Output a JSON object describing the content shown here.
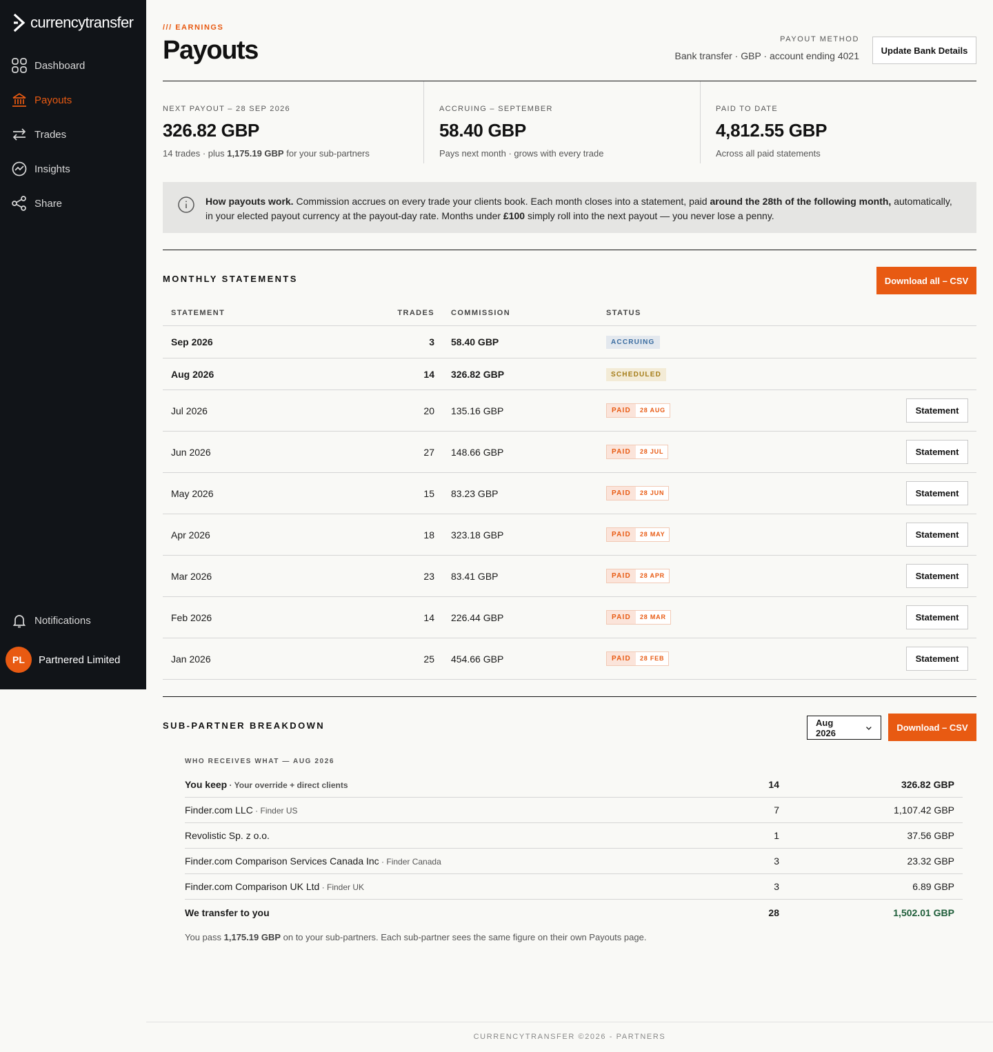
{
  "brand": {
    "name": "currencytransfer",
    "accent": "#e85a12"
  },
  "sidebar": {
    "items": [
      {
        "label": "Dashboard",
        "icon": "grid-icon"
      },
      {
        "label": "Payouts",
        "icon": "bank-icon",
        "active": true
      },
      {
        "label": "Trades",
        "icon": "arrows-exchange-icon"
      },
      {
        "label": "Insights",
        "icon": "chart-circle-icon"
      },
      {
        "label": "Share",
        "icon": "share-icon"
      }
    ],
    "notifications": "Notifications",
    "user": {
      "initials": "PL",
      "name": "Partnered Limited"
    }
  },
  "header": {
    "eyebrow": "/// EARNINGS",
    "title": "Payouts",
    "payout_method_label": "PAYOUT METHOD",
    "payout_method_value": "Bank transfer · GBP · account ending 4021",
    "update_bank_label": "Update Bank Details"
  },
  "summary": [
    {
      "label": "NEXT PAYOUT – 28 SEP 2026",
      "value": "326.82 GBP",
      "sub_pre": "14 trades · plus ",
      "sub_bold": "1,175.19 GBP",
      "sub_post": " for your sub-partners"
    },
    {
      "label": "ACCRUING – SEPTEMBER",
      "value": "58.40 GBP",
      "sub_pre": "Pays next month · grows with every trade",
      "sub_bold": "",
      "sub_post": ""
    },
    {
      "label": "PAID TO DATE",
      "value": "4,812.55 GBP",
      "sub_pre": "Across all paid statements",
      "sub_bold": "",
      "sub_post": ""
    }
  ],
  "info": {
    "bold1": "How payouts work.",
    "t1": " Commission accrues on every trade your clients book. Each month closes into a statement, paid ",
    "bold2": "around the 28th of the following month,",
    "t2": " automatically, in your elected payout currency at the payout-day rate. Months under ",
    "bold3": "£100",
    "t3": " simply roll into the next payout — you never lose a penny."
  },
  "statements": {
    "title": "MONTHLY STATEMENTS",
    "download_label": "Download all – CSV",
    "columns": [
      "STATEMENT",
      "TRADES",
      "COMMISSION",
      "STATUS"
    ],
    "rows": [
      {
        "month": "Sep 2026",
        "trades": "3",
        "commission": "58.40 GBP",
        "status": "ACCRUING",
        "type": "accruing"
      },
      {
        "month": "Aug 2026",
        "trades": "14",
        "commission": "326.82 GBP",
        "status": "SCHEDULED",
        "type": "scheduled"
      },
      {
        "month": "Jul 2026",
        "trades": "20",
        "commission": "135.16 GBP",
        "status": "PAID",
        "date": "28 AUG",
        "type": "paid",
        "action": "Statement"
      },
      {
        "month": "Jun 2026",
        "trades": "27",
        "commission": "148.66 GBP",
        "status": "PAID",
        "date": "28 JUL",
        "type": "paid",
        "action": "Statement"
      },
      {
        "month": "May 2026",
        "trades": "15",
        "commission": "83.23 GBP",
        "status": "PAID",
        "date": "28 JUN",
        "type": "paid",
        "action": "Statement"
      },
      {
        "month": "Apr 2026",
        "trades": "18",
        "commission": "323.18 GBP",
        "status": "PAID",
        "date": "28 MAY",
        "type": "paid",
        "action": "Statement"
      },
      {
        "month": "Mar 2026",
        "trades": "23",
        "commission": "83.41 GBP",
        "status": "PAID",
        "date": "28 APR",
        "type": "paid",
        "action": "Statement"
      },
      {
        "month": "Feb 2026",
        "trades": "14",
        "commission": "226.44 GBP",
        "status": "PAID",
        "date": "28 MAR",
        "type": "paid",
        "action": "Statement"
      },
      {
        "month": "Jan 2026",
        "trades": "25",
        "commission": "454.66 GBP",
        "status": "PAID",
        "date": "28 FEB",
        "type": "paid",
        "action": "Statement"
      }
    ]
  },
  "subpartners": {
    "title": "SUB-PARTNER BREAKDOWN",
    "period_selected": "Aug 2026",
    "download_label": "Download – CSV",
    "eyebrow": "WHO RECEIVES WHAT — AUG 2026",
    "rows": [
      {
        "name": "You keep",
        "sub": "Your override + direct clients",
        "trades": "14",
        "amount": "326.82 GBP",
        "style": "bold"
      },
      {
        "name": "Finder.com LLC",
        "sub": "Finder US",
        "trades": "7",
        "amount": "1,107.42 GBP",
        "style": ""
      },
      {
        "name": "Revolistic Sp. z o.o.",
        "sub": "",
        "trades": "1",
        "amount": "37.56 GBP",
        "style": ""
      },
      {
        "name": "Finder.com Comparison Services Canada Inc",
        "sub": "Finder Canada",
        "trades": "3",
        "amount": "23.32 GBP",
        "style": ""
      },
      {
        "name": "Finder.com Comparison UK Ltd",
        "sub": "Finder UK",
        "trades": "3",
        "amount": "6.89 GBP",
        "style": ""
      },
      {
        "name": "We transfer to you",
        "sub": "",
        "trades": "28",
        "amount": "1,502.01 GBP",
        "style": "total"
      }
    ],
    "note_pre": "You pass ",
    "note_bold": "1,175.19 GBP",
    "note_post": " on to your sub-partners. Each sub-partner sees the same figure on their own Payouts page."
  },
  "footer": "CURRENCYTRANSFER ©2026 - PARTNERS"
}
